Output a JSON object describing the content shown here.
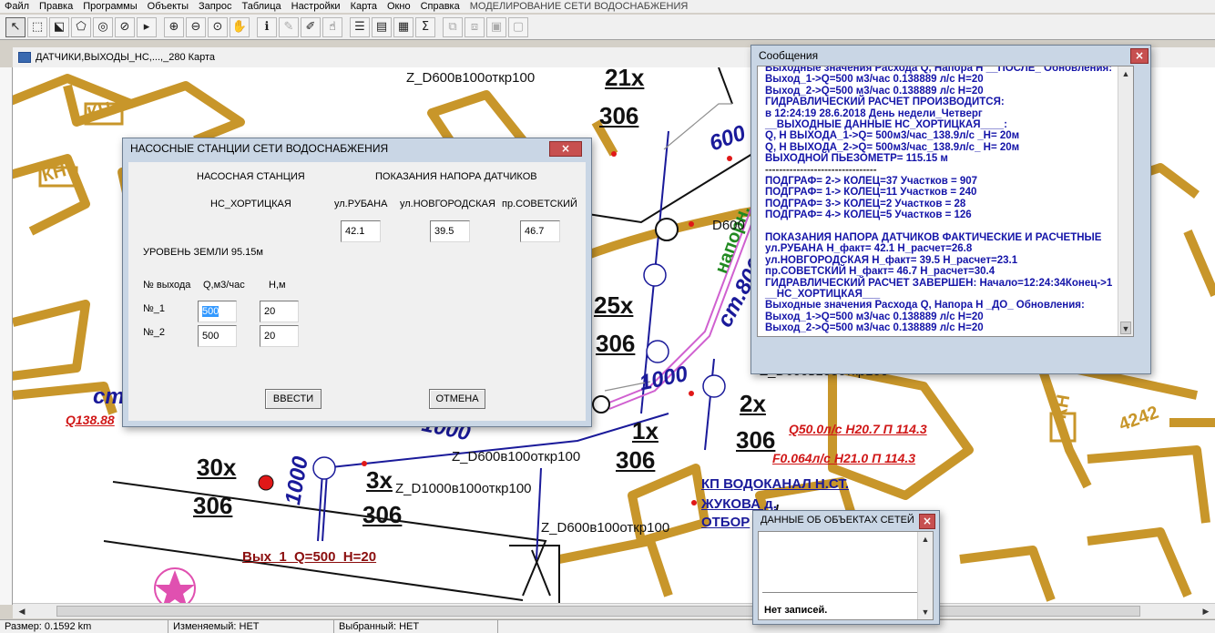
{
  "menu": [
    "Файл",
    "Правка",
    "Программы",
    "Объекты",
    "Запрос",
    "Таблица",
    "Настройки",
    "Карта",
    "Окно",
    "Справка"
  ],
  "app_title": "МОДЕЛИРОВАНИЕ СЕТИ ВОДОСНАБЖЕНИЯ",
  "toolbar": [
    {
      "icon": "arrow-pointer-icon",
      "glyph": "↖",
      "state": "pressed"
    },
    {
      "icon": "select-region-icon",
      "glyph": "⬚",
      "state": "normal"
    },
    {
      "icon": "select-multiple-icon",
      "glyph": "⬕",
      "state": "normal"
    },
    {
      "icon": "select-polygon-icon",
      "glyph": "⬠",
      "state": "normal"
    },
    {
      "icon": "select-radius-icon",
      "glyph": "◎",
      "state": "normal"
    },
    {
      "icon": "clear-selection-icon",
      "glyph": "⊘",
      "state": "normal"
    },
    {
      "icon": "select-pointer-icon",
      "glyph": "▸",
      "state": "normal",
      "sep": true
    },
    {
      "icon": "zoom-in-icon",
      "glyph": "⊕",
      "state": "normal"
    },
    {
      "icon": "zoom-out-icon",
      "glyph": "⊖",
      "state": "normal"
    },
    {
      "icon": "zoom-window-icon",
      "glyph": "⊙",
      "state": "normal"
    },
    {
      "icon": "pan-hand-icon",
      "glyph": "✋",
      "state": "normal",
      "sep": true
    },
    {
      "icon": "info-icon",
      "glyph": "ℹ",
      "state": "normal"
    },
    {
      "icon": "pencil-icon",
      "glyph": "✎",
      "state": "disabled"
    },
    {
      "icon": "label-icon",
      "glyph": "✐",
      "state": "normal"
    },
    {
      "icon": "hand-point-icon",
      "glyph": "☝",
      "state": "normal",
      "sep": true
    },
    {
      "icon": "layers-icon",
      "glyph": "☰",
      "state": "normal"
    },
    {
      "icon": "legend-icon",
      "glyph": "▤",
      "state": "normal"
    },
    {
      "icon": "table-icon",
      "glyph": "▦",
      "state": "normal"
    },
    {
      "icon": "sum-icon",
      "glyph": "Σ",
      "state": "normal",
      "sep": true
    },
    {
      "icon": "network-icon",
      "glyph": "⧉",
      "state": "disabled"
    },
    {
      "icon": "network-edit-icon",
      "glyph": "⧈",
      "state": "disabled"
    },
    {
      "icon": "report-icon",
      "glyph": "▣",
      "state": "disabled"
    },
    {
      "icon": "report-edit-icon",
      "glyph": "▢",
      "state": "disabled"
    }
  ],
  "map_window": {
    "title": "ДАТЧИКИ,ВЫХОДЫ_НС,...,_280 Карта"
  },
  "map_labels": [
    {
      "text": "Z_D600в100откр100",
      "style": "small",
      "id": "pipe-label-1"
    },
    {
      "text": "21x",
      "style": "big",
      "id": "node-label-21x"
    },
    {
      "text": "306",
      "style": "big",
      "id": "node-label-306-a"
    },
    {
      "text": "600",
      "style": "blue",
      "id": "pipe-diameter-600"
    },
    {
      "text": "25x",
      "style": "big",
      "id": "node-label-25x"
    },
    {
      "text": "306",
      "style": "big",
      "id": "node-label-306-b"
    },
    {
      "text": "ст.800",
      "style": "blue",
      "id": "pipe-st800"
    },
    {
      "text": "напорн.",
      "style": "green",
      "id": "pipe-napor"
    },
    {
      "text": "D600",
      "style": "small",
      "id": "pipe-label-d600"
    },
    {
      "text": "1000",
      "style": "blue",
      "id": "pipe-diameter-1000-a"
    },
    {
      "text": "2x",
      "style": "big",
      "id": "node-label-2x"
    },
    {
      "text": "306",
      "style": "big",
      "id": "node-label-306-c"
    },
    {
      "text": "1x",
      "style": "big",
      "id": "node-label-1x"
    },
    {
      "text": "306",
      "style": "big",
      "id": "node-label-306-d"
    },
    {
      "text": "Q50.0л/с  H20.7  П  114.3",
      "style": "red",
      "id": "flow-label-q50"
    },
    {
      "text": "F0.064л/с  H21.0  П  114.3",
      "style": "red",
      "id": "flow-label-f0064"
    },
    {
      "text": "Z_D600в100откр100",
      "style": "small",
      "id": "pipe-label-2"
    },
    {
      "text": "Z_D1000в100откр100",
      "style": "small",
      "id": "pipe-label-3"
    },
    {
      "text": "30x",
      "style": "big",
      "id": "node-label-30x"
    },
    {
      "text": "306",
      "style": "big",
      "id": "node-label-306-e"
    },
    {
      "text": "3x",
      "style": "big",
      "id": "node-label-3x"
    },
    {
      "text": "306",
      "style": "big",
      "id": "node-label-306-f"
    },
    {
      "text": "1000",
      "style": "blue",
      "id": "pipe-diameter-1000-b"
    },
    {
      "text": "Вых_1_Q=500_H=20",
      "style": "darkred",
      "id": "outlet-label"
    },
    {
      "text": "Z_D600в100откр100",
      "style": "small",
      "id": "pipe-label-4"
    },
    {
      "text": "КП ВОДОКАНАЛ Н.СТ.",
      "style": "blue",
      "id": "station-label-1"
    },
    {
      "text": "ЖУКОВА д.",
      "style": "blue",
      "id": "station-label-2"
    },
    {
      "text": "ОТБОР",
      "style": "blue",
      "id": "station-label-3"
    },
    {
      "text": "ст",
      "style": "blue",
      "id": "pipe-st"
    },
    {
      "text": "Q138.88",
      "style": "red",
      "id": "flow-label-q138"
    },
    {
      "text": "Z_D600в100откр100",
      "style": "small",
      "id": "pipe-label-5"
    },
    {
      "text": "4242",
      "style": "orange",
      "id": "building-number-4242"
    },
    {
      "text": "КН",
      "style": "orange",
      "id": "building-kn-1"
    },
    {
      "text": "КН",
      "style": "orange",
      "id": "building-kn-2"
    },
    {
      "text": "КН",
      "style": "orange",
      "id": "building-kn-3"
    },
    {
      "text": "1000",
      "style": "blue",
      "id": "pipe-diameter-1000-c"
    }
  ],
  "pump_dialog": {
    "title": "НАСОСНЫЕ СТАНЦИИ СЕТИ ВОДОСНАБЖЕНИЯ",
    "close": "×",
    "col_station": "НАСОСНАЯ СТАНЦИЯ",
    "col_sensors": "ПОКАЗАНИЯ НАПОРА ДАТЧИКОВ",
    "station_name": "НС_ХОРТИЦКАЯ",
    "sensors": [
      {
        "name": "ул.РУБАНА",
        "value": "42.1"
      },
      {
        "name": "ул.НОВГОРОДСКАЯ",
        "value": "39.5"
      },
      {
        "name": "пр.СОВЕТСКИЙ",
        "value": "46.7"
      }
    ],
    "ground_level": "УРОВЕНЬ ЗЕМЛИ    95.15м",
    "hdr_outlet": "№ выхода",
    "hdr_q": "Q,м3/час",
    "hdr_h": "Н,м",
    "outlets": [
      {
        "label": "№_1",
        "q": "500",
        "h": "20",
        "selected": true
      },
      {
        "label": "№_2",
        "q": "500",
        "h": "20",
        "selected": false
      }
    ],
    "ok": "ВВЕСТИ",
    "cancel": "ОТМЕНА"
  },
  "messages": {
    "title": "Сообщения",
    "close": "×",
    "lines": [
      "Выходные значения Расхода Q, Напора Н __ПОСЛЕ_ Обновления:",
      "Выход_1->Q=500 м3/час 0.138889 л/с Н=20",
      "Выход_2->Q=500 м3/час 0.138889 л/с Н=20",
      "ГИДРАВЛИЧЕСКИЙ РАСЧЕТ ПРОИЗВОДИТСЯ:",
      "  в 12:24:19 28.6.2018 День недели_Четверг",
      "__ВЫХОДНЫЕ ДАННЫЕ НС_ХОРТИЦКАЯ____:",
      "Q, Н ВЫХОДА_1->Q= 500м3/час_138.9л/с _Н= 20м",
      "Q, Н ВЫХОДА_2->Q= 500м3/час_138.9л/с_ Н= 20м",
      "ВЫХОДНОЙ ПЬЕЗОМЕТР= 115.15 м",
      "--------------------------------",
      "ПОДГРАФ= 2-> КОЛЕЦ=37 Участков = 907",
      "ПОДГРАФ= 1-> КОЛЕЦ=11 Участков = 240",
      "ПОДГРАФ= 3-> КОЛЕЦ=2 Участков = 28",
      "ПОДГРАФ= 4-> КОЛЕЦ=5 Участков = 126",
      "",
      "ПОКАЗАНИЯ НАПОРА ДАТЧИКОВ ФАКТИЧЕСКИЕ И РАСЧЕТНЫЕ",
      " ул.РУБАНА              Н_факт= 42.1 Н_расчет=26.8",
      " ул.НОВГОРОДСКАЯ Н_факт= 39.5 Н_расчет=23.1",
      "  пр.СОВЕТСКИЙ         Н_факт= 46.7 Н_расчет=30.4",
      "ГИДРАВЛИЧЕСКИЙ РАСЧЕТ ЗАВЕРШЕН: Начало=12:24:34Конец->1",
      "__НС_ХОРТИЦКАЯ___",
      "Выходные значения Расхода Q, Напора Н _ДО_ Обновления:",
      "Выход_1->Q=500 м3/час 0.138889 л/с Н=20",
      "Выход_2->Q=500 м3/час 0.138889 л/с Н=20"
    ]
  },
  "objects_panel": {
    "title": "ДАННЫЕ ОБ ОБЪЕКТАХ СЕТЕЙ",
    "close": "×",
    "empty": "Нет записей."
  },
  "status": {
    "size": "Размер: 0.1592 km",
    "editable": "Изменяемый: НЕТ",
    "selected": "Выбранный: НЕТ"
  },
  "colors": {
    "building": "#c8962a",
    "pipe_main": "#1a1a9a",
    "pipe_pink": "#d060d0",
    "label_red": "#d01818",
    "label_green": "#208a20",
    "msg_text": "#1414a8"
  }
}
